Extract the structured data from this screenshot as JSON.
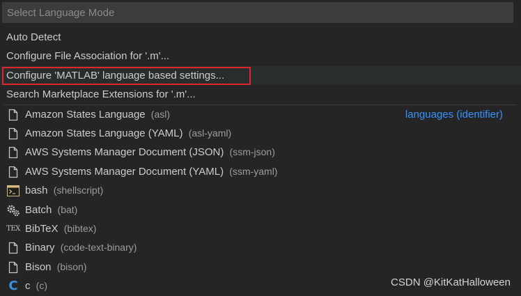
{
  "search": {
    "placeholder": "Select Language Mode",
    "value": ""
  },
  "commands": [
    {
      "label": "Auto Detect"
    },
    {
      "label": "Configure File Association for '.m'..."
    },
    {
      "label": "Configure 'MATLAB' language based settings..."
    },
    {
      "label": "Search Marketplace Extensions for '.m'..."
    }
  ],
  "languages": [
    {
      "name": "Amazon States Language",
      "id": "(asl)",
      "icon": "file-icon",
      "description": "languages (identifier)"
    },
    {
      "name": "Amazon States Language (YAML)",
      "id": "(asl-yaml)",
      "icon": "file-icon"
    },
    {
      "name": "AWS Systems Manager Document (JSON)",
      "id": "(ssm-json)",
      "icon": "file-icon"
    },
    {
      "name": "AWS Systems Manager Document (YAML)",
      "id": "(ssm-yaml)",
      "icon": "file-icon"
    },
    {
      "name": "bash",
      "id": "(shellscript)",
      "icon": "terminal-icon"
    },
    {
      "name": "Batch",
      "id": "(bat)",
      "icon": "gears-icon"
    },
    {
      "name": "BibTeX",
      "id": "(bibtex)",
      "icon": "tex-icon",
      "icon_text": "TEX"
    },
    {
      "name": "Binary",
      "id": "(code-text-binary)",
      "icon": "file-icon"
    },
    {
      "name": "Bison",
      "id": "(bison)",
      "icon": "file-icon"
    },
    {
      "name": "c",
      "id": "(c)",
      "icon": "c-language-icon",
      "icon_text": "C"
    }
  ],
  "colors": {
    "accent": "#3794ff",
    "selection_border": "#e0262d",
    "background": "#252526"
  },
  "watermark": "CSDN @KitKatHalloween"
}
